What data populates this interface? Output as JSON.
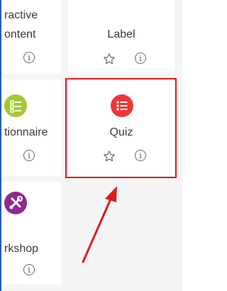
{
  "modules": [
    {
      "id": "interactive",
      "label_line1": "ractive",
      "label_line2": "ontent",
      "favourite": false
    },
    {
      "id": "label",
      "label": "Label",
      "favourite": false
    },
    {
      "id": "questionnaire",
      "label": "tionnaire",
      "icon": "list-icon",
      "icon_color": "#a4c932"
    },
    {
      "id": "quiz",
      "label": "Quiz",
      "icon": "list-icon",
      "icon_color": "#ef3838",
      "highlighted": true
    },
    {
      "id": "workshop",
      "label": "rkshop",
      "icon": "tools-icon",
      "icon_color": "#8e2a8e"
    }
  ],
  "info_glyph": "i",
  "colors": {
    "highlight": "#e01b1b",
    "arrow": "#e01b1b"
  }
}
